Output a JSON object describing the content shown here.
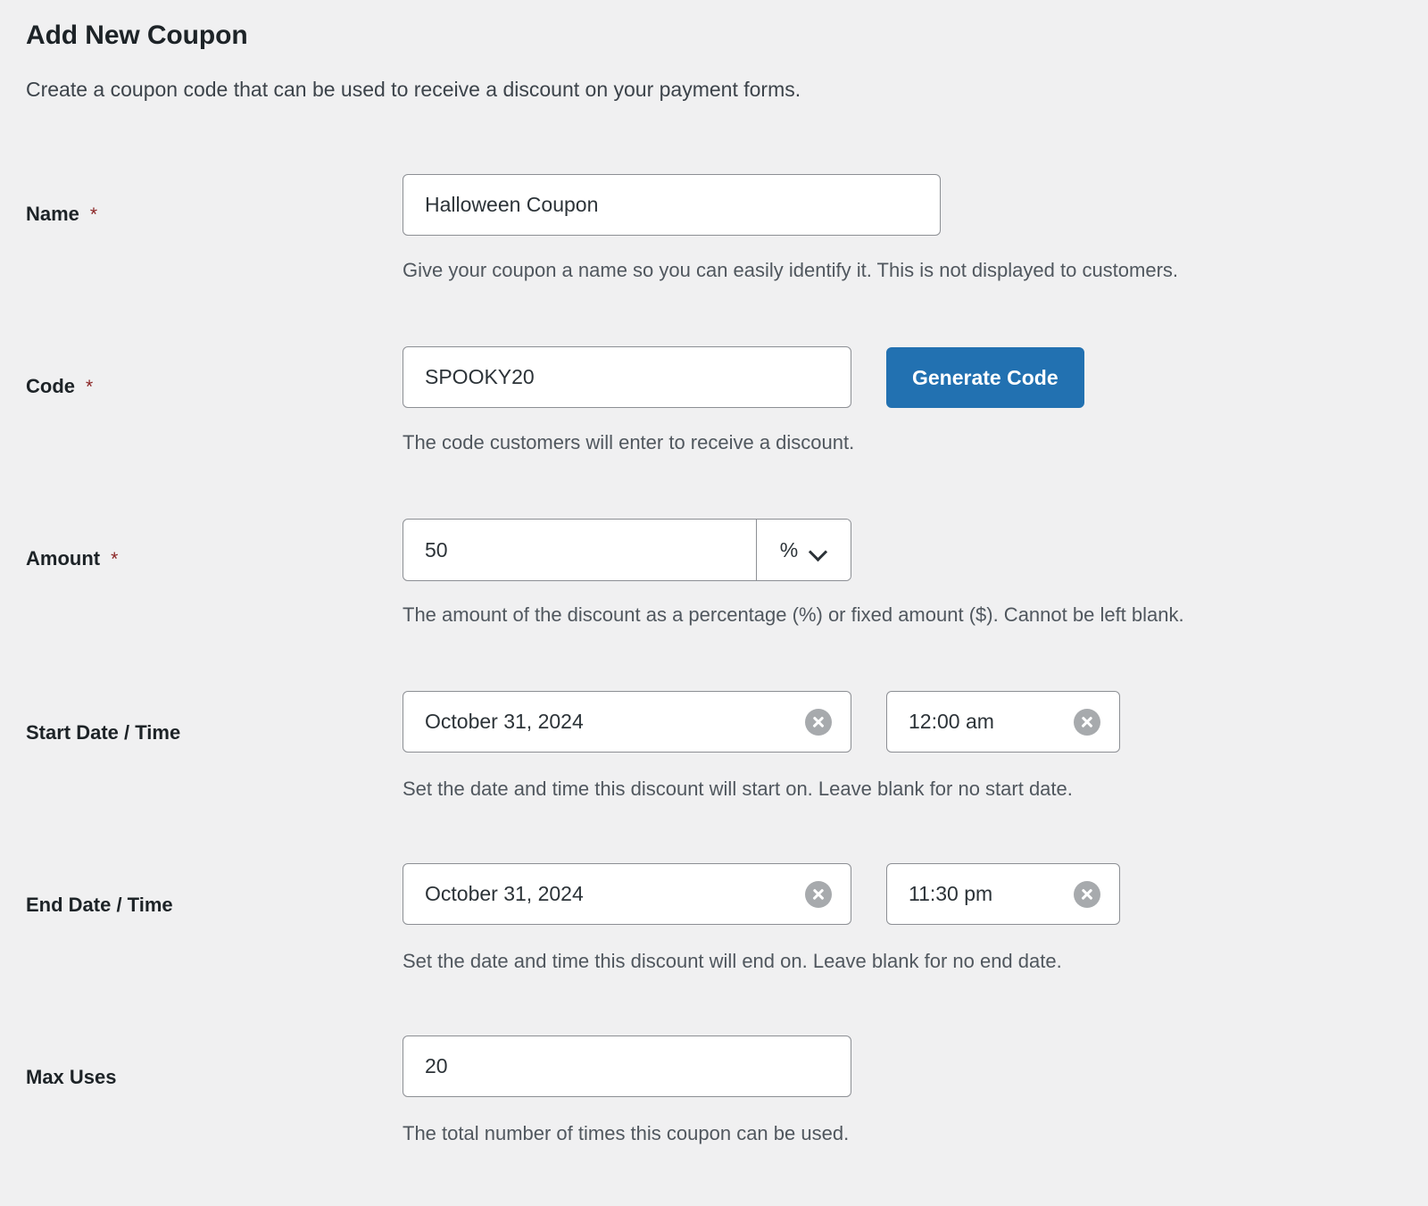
{
  "header": {
    "title": "Add New Coupon",
    "subtitle": "Create a coupon code that can be used to receive a discount on your payment forms."
  },
  "colors": {
    "page_background": "#f0f0f1",
    "primary_button": "#2271b1",
    "required_asterisk": "#8a2424",
    "input_border": "#8c8f94",
    "help_text": "#50575e",
    "clear_icon": "#a7aaad"
  },
  "fields": {
    "name": {
      "label": "Name",
      "required_marker": "*",
      "value": "Halloween Coupon",
      "placeholder": "",
      "help": "Give your coupon a name so you can easily identify it. This is not displayed to customers."
    },
    "code": {
      "label": "Code",
      "required_marker": "*",
      "value": "SPOOKY20",
      "placeholder": "",
      "help": "The code customers will enter to receive a discount.",
      "generate_button": "Generate Code"
    },
    "amount": {
      "label": "Amount",
      "required_marker": "*",
      "value": "50",
      "placeholder": "",
      "unit_selected": "%",
      "unit_options": [
        "%",
        "$"
      ],
      "help": "The amount of the discount as a percentage (%) or fixed amount ($). Cannot be left blank."
    },
    "start": {
      "label": "Start Date / Time",
      "date_value": "October 31, 2024",
      "date_placeholder": "",
      "time_value": "12:00 am",
      "time_placeholder": "",
      "help": "Set the date and time this discount will start on. Leave blank for no start date."
    },
    "end": {
      "label": "End Date / Time",
      "date_value": "October 31, 2024",
      "date_placeholder": "",
      "time_value": "11:30 pm",
      "time_placeholder": "",
      "help": "Set the date and time this discount will end on. Leave blank for no end date."
    },
    "max_uses": {
      "label": "Max Uses",
      "value": "20",
      "placeholder": "",
      "help": "The total number of times this coupon can be used."
    }
  }
}
